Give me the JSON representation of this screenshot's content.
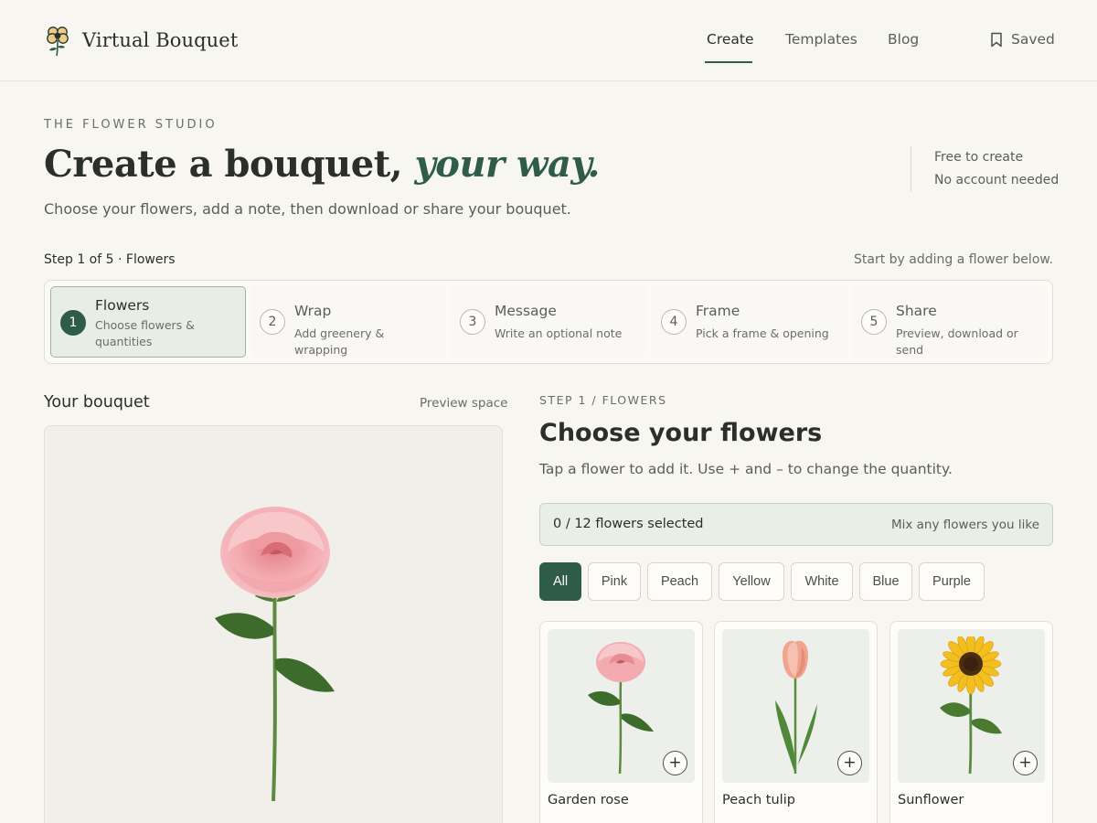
{
  "header": {
    "brand_name": "Virtual Bouquet",
    "nav": [
      {
        "label": "Create",
        "active": true
      },
      {
        "label": "Templates",
        "active": false
      },
      {
        "label": "Blog",
        "active": false
      }
    ],
    "saved_label": "Saved"
  },
  "hero": {
    "eyebrow": "THE FLOWER STUDIO",
    "title_main": "Create a bouquet,",
    "title_accent": "your way.",
    "subtitle": "Choose your flowers, add a note, then download or share your bouquet.",
    "side": [
      "Free to create",
      "No account needed"
    ]
  },
  "steps": {
    "meta": "Step 1 of 5 · Flowers",
    "hint": "Start by adding a flower below.",
    "items": [
      {
        "num": "1",
        "title": "Flowers",
        "desc": "Choose flowers & quantities",
        "active": true
      },
      {
        "num": "2",
        "title": "Wrap",
        "desc": "Add greenery & wrapping",
        "active": false
      },
      {
        "num": "3",
        "title": "Message",
        "desc": "Write an optional note",
        "active": false
      },
      {
        "num": "4",
        "title": "Frame",
        "desc": "Pick a frame & opening",
        "active": false
      },
      {
        "num": "5",
        "title": "Share",
        "desc": "Preview, download or send",
        "active": false
      }
    ]
  },
  "preview": {
    "title": "Your bouquet",
    "note": "Preview space"
  },
  "chooser": {
    "eyebrow": "STEP 1 / FLOWERS",
    "title": "Choose your flowers",
    "subtitle": "Tap a flower to add it. Use + and – to change the quantity.",
    "counter_text": "0 / 12 flowers selected",
    "counter_hint": "Mix any flowers you like",
    "filters": [
      {
        "label": "All",
        "active": true
      },
      {
        "label": "Pink",
        "active": false
      },
      {
        "label": "Peach",
        "active": false
      },
      {
        "label": "Yellow",
        "active": false
      },
      {
        "label": "White",
        "active": false
      },
      {
        "label": "Blue",
        "active": false
      },
      {
        "label": "Purple",
        "active": false
      }
    ],
    "flowers": [
      {
        "name": "Garden rose",
        "icon": "rose-image",
        "add_label": "+"
      },
      {
        "name": "Peach tulip",
        "icon": "tulip-image",
        "add_label": "+"
      },
      {
        "name": "Sunflower",
        "icon": "sunflower-image",
        "add_label": "+"
      }
    ]
  },
  "colors": {
    "accent": "#2f5c49",
    "background": "#f8f6f1",
    "counter_bg": "#e9eee6"
  }
}
